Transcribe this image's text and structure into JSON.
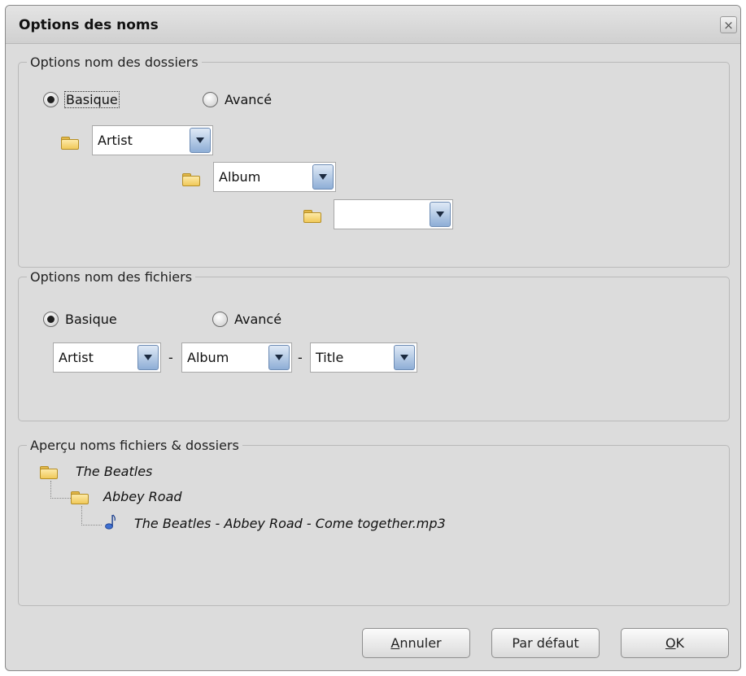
{
  "dialog": {
    "title": "Options des noms",
    "close_label": "×"
  },
  "folders_group": {
    "legend": "Options nom des dossiers",
    "radio_basic": "Basique",
    "radio_advanced": "Avancé",
    "selected": "Basique",
    "levels": [
      "Artist",
      "Album",
      ""
    ]
  },
  "files_group": {
    "legend": "Options nom des fichiers",
    "radio_basic": "Basique",
    "radio_advanced": "Avancé",
    "selected": "Basique",
    "fields": [
      "Artist",
      "Album",
      "Title"
    ],
    "separator": "-"
  },
  "preview_group": {
    "legend": "Aperçu noms fichiers & dossiers",
    "artist_folder": "The Beatles",
    "album_folder": "Abbey Road",
    "file_name": "The Beatles - Abbey Road - Come together.mp3"
  },
  "buttons": {
    "cancel_accel": "A",
    "cancel_rest": "nnuler",
    "default": "Par défaut",
    "ok_accel": "O",
    "ok_rest": "K"
  }
}
